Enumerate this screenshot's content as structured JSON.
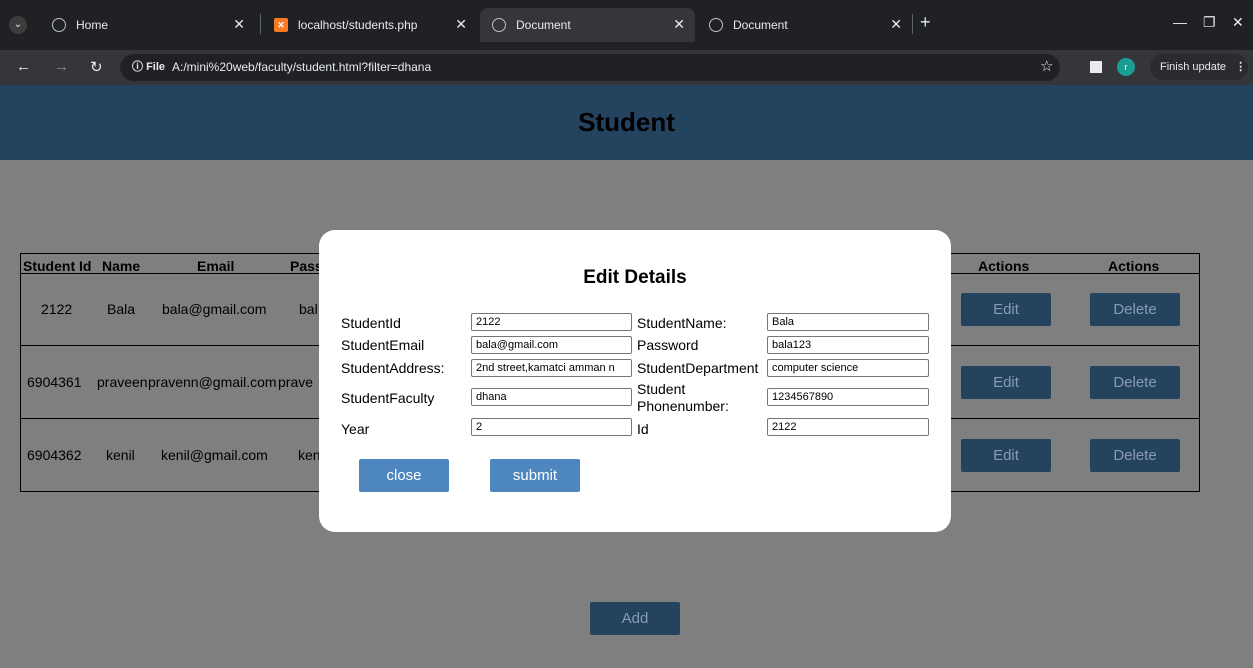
{
  "browser": {
    "tabs": [
      {
        "title": "Home"
      },
      {
        "title": "localhost/students.php"
      },
      {
        "title": "Document"
      },
      {
        "title": "Document"
      }
    ],
    "url_chip": "File",
    "url": "A:/mini%20web/faculty/student.html?filter=dhana",
    "finish_update": "Finish update",
    "avatar_letter": "r"
  },
  "page": {
    "title": "Student",
    "table": {
      "headers": [
        "Student Id",
        "Name",
        "Email",
        "Pass",
        "Actions",
        "Actions"
      ],
      "rows": [
        {
          "id": "2122",
          "name": "Bala",
          "email": "bala@gmail.com",
          "pass": "bal"
        },
        {
          "id": "6904361",
          "name": "praveen",
          "email": "pravenn@gmail.com",
          "pass": "prave"
        },
        {
          "id": "6904362",
          "name": "kenil",
          "email": "kenil@gmail.com",
          "pass": "ken"
        }
      ],
      "edit_label": "Edit",
      "delete_label": "Delete"
    },
    "add_label": "Add"
  },
  "modal": {
    "title": "Edit Details",
    "fields": {
      "student_id": {
        "label": "StudentId",
        "value": "2122"
      },
      "student_name": {
        "label": "StudentName:",
        "value": "Bala"
      },
      "student_email": {
        "label": "StudentEmail",
        "value": "bala@gmail.com"
      },
      "password": {
        "label": "Password",
        "value": "bala123"
      },
      "student_address": {
        "label": "StudentAddress:",
        "value": "2nd street,kamatci amman n"
      },
      "student_department": {
        "label": "StudentDepartment",
        "value": "computer science"
      },
      "student_faculty": {
        "label": "StudentFaculty",
        "value": "dhana"
      },
      "student_phone": {
        "label_line1": "Student",
        "label_line2": "Phonenumber:",
        "value": "1234567890"
      },
      "year": {
        "label": "Year",
        "value": "2"
      },
      "id": {
        "label": "Id",
        "value": "2122"
      }
    },
    "close_label": "close",
    "submit_label": "submit"
  }
}
